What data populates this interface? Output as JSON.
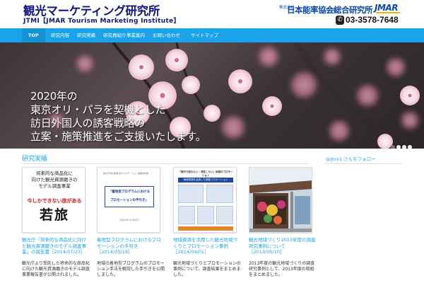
{
  "header": {
    "title": "観光マーケティング研究所",
    "subtitle": "JTMI【JMAR Tourism Marketing Institute】",
    "corp_prefix": "株式会社",
    "corp_name": "日本能率協会総合研究所",
    "corp_logo": "JMAR",
    "phone": "03-3578-7648"
  },
  "nav": {
    "items": [
      {
        "label": "TOP"
      },
      {
        "label": "研究内容"
      },
      {
        "label": "研究実績"
      },
      {
        "label": "研究員紹介"
      },
      {
        "label": "事業案内"
      },
      {
        "label": "お問い合わせ"
      },
      {
        "label": "サイトマップ"
      }
    ]
  },
  "hero": {
    "lines": [
      "2020年の",
      "東京オリ・パラを契機とした",
      "訪日外国人の誘客戦略の",
      "立案・施策推進をご支援いたします。"
    ]
  },
  "content": {
    "section_title": "研究実績",
    "follow_link": "@jtmi1 さんをフォロー",
    "cards": [
      {
        "thumb_lines": [
          "将来的な商品化に",
          "向けた観光資源磨きの",
          "モデル調査事業"
        ],
        "thumb_banner": "今しかできない旅がある",
        "thumb_big": "若旅",
        "title": "観光庁「将来的な商品化に向けた観光資源磨きのモデル調査事業」の報告書",
        "date": "［2014/07/23］",
        "desc": "観光庁より受託した将来的な商品化に向けた観光資源磨きのモデル調査事業報告書が公開されました。"
      },
      {
        "thumb_head": "観光庁委託事業 訪日プロモーション事業報告書",
        "thumb_line1": "「着地型プログラムにおける",
        "thumb_line2": "プロモーションの手引き」",
        "thumb_foot": "平成26年3月 観光庁",
        "title": "着地型プログラムにおけるプロモーションの手引き",
        "date": "［2014/05/19］",
        "desc": "地域の着地型プログラムのプロモーション手法を解説した手引きを公開しました。"
      },
      {
        "thumb_head": "「旅行で訪れたい・滞在したい」地域のプロモーション",
        "thumb_blue": "地域資源を活用した誘客プロモーション",
        "title": "地域資源を活用した観光地域づくりとプロモーション事例",
        "date": "［2014/04/01］",
        "desc": "観光地域づくりとプロモーションの事例について、調査結果をまとめました。"
      },
      {
        "title": "観光地域づくり2013年度の調査研究事例について",
        "date": "［2013/05/10］",
        "desc": "2013年度の観光地域づくりの調査研究事例として、2013年度の取組をまとめました。"
      }
    ]
  }
}
